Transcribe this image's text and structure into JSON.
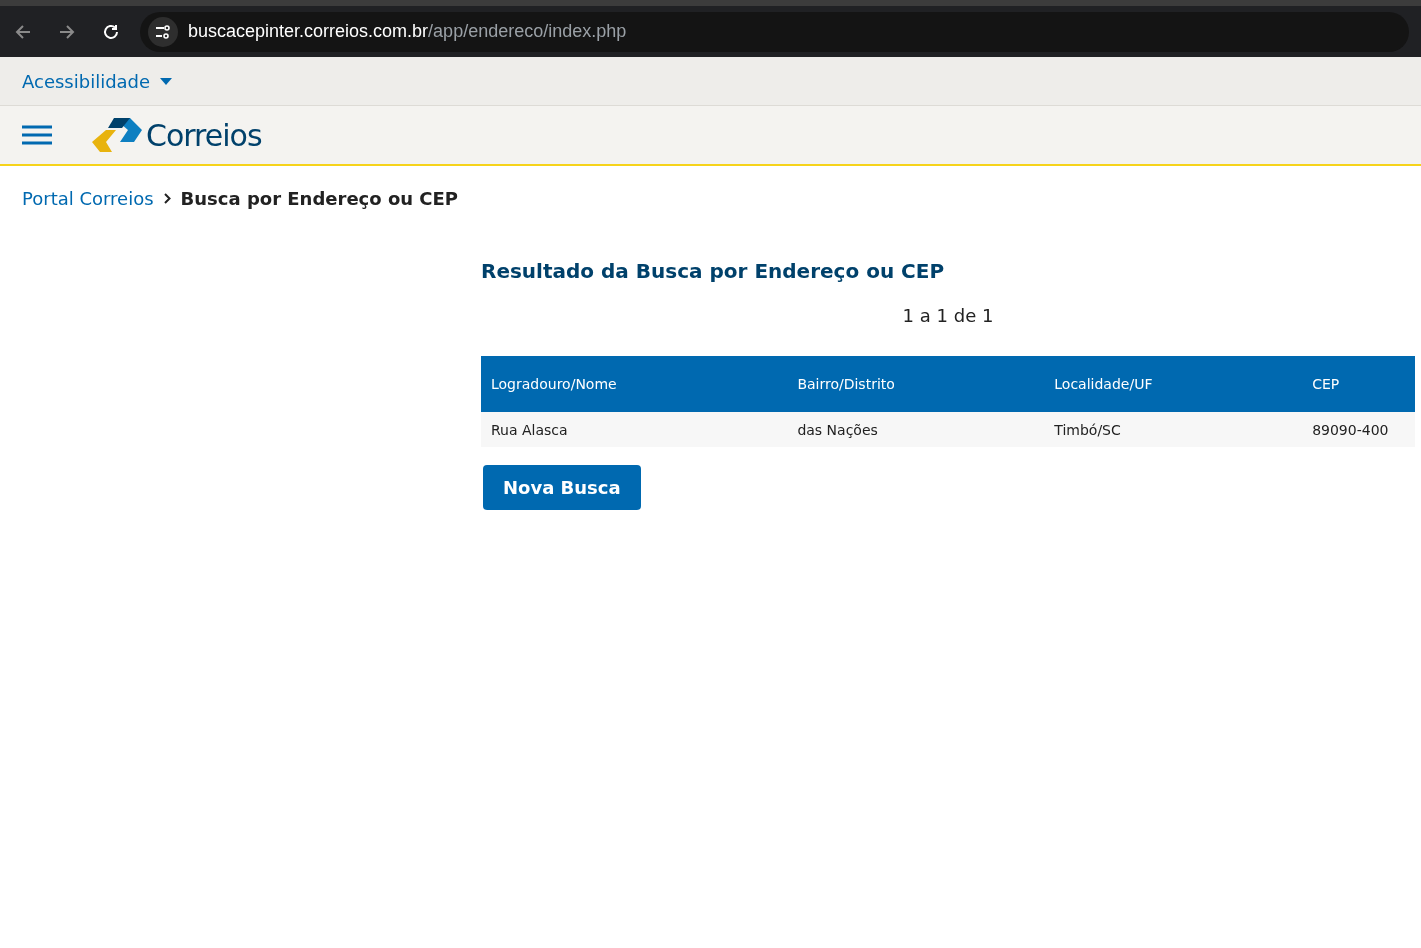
{
  "browser": {
    "url_host": "buscacepinter.correios.com.br",
    "url_path": "/app/endereco/index.php"
  },
  "accessibility_menu": {
    "label": "Acessibilidade"
  },
  "header": {
    "logo_text": "Correios"
  },
  "breadcrumb": [
    {
      "label": "Portal Correios",
      "kind": "link"
    },
    {
      "label": "Busca por Endereço ou CEP",
      "kind": "current"
    }
  ],
  "result": {
    "title": "Resultado da Busca por Endereço ou CEP",
    "pagination": "1 a 1 de 1",
    "table": {
      "columns": [
        "Logradouro/Nome",
        "Bairro/Distrito",
        "Localidade/UF",
        "CEP"
      ],
      "rows": [
        [
          "Rua Alasca",
          "das Nações",
          "Timbó/SC",
          "89090-400"
        ]
      ]
    },
    "button": "Nova Busca"
  }
}
